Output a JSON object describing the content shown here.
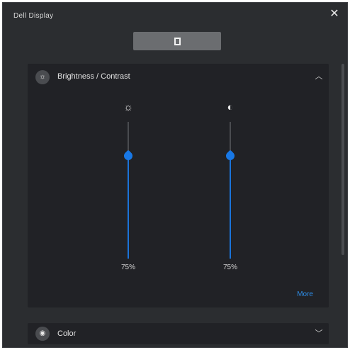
{
  "window": {
    "title": "Dell Display",
    "close_icon": "close-icon"
  },
  "mode_button": {
    "icon": "monitor-icon"
  },
  "brightness_panel": {
    "title": "Brightness / Contrast",
    "icon": "brightness-contrast-icon",
    "icon_glyph": "☼",
    "chevron": "chevron-up-icon",
    "chevron_glyph": "︿",
    "sliders": [
      {
        "name": "brightness",
        "icon": "sun-icon",
        "icon_glyph": "☼",
        "value": 75,
        "value_text": "75%"
      },
      {
        "name": "contrast",
        "icon": "contrast-icon",
        "icon_glyph": "◐",
        "value": 75,
        "value_text": "75%"
      }
    ],
    "more_label": "More"
  },
  "color_panel": {
    "title": "Color",
    "icon": "color-icon",
    "icon_glyph": "◉",
    "chevron": "chevron-down-icon",
    "chevron_glyph": "﹀"
  }
}
